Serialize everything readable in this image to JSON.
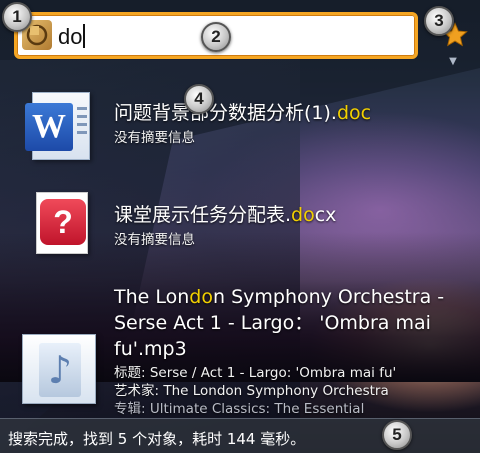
{
  "search": {
    "query": "do",
    "app_icon": "app-logo-icon",
    "favorite_icon": "star-icon",
    "dropdown_icon": "chevron-down-icon"
  },
  "results": [
    {
      "name_prefix": "问题背景部分数据分析(1).",
      "name_match": "do",
      "name_suffix": "c",
      "subtitle": "没有摘要信息",
      "icon": "word-document-icon"
    },
    {
      "name_prefix": "课堂展示任务分配表.",
      "name_match": "do",
      "name_suffix": "cx",
      "subtitle": "没有摘要信息",
      "icon": "unknown-file-icon"
    },
    {
      "line1_prefix": "The Lon",
      "line1_match": "do",
      "line1_suffix": "n Symphony Orchestra -",
      "line2": "Serse Act 1 - Largo： 'Ombra mai",
      "line3": "fu'.mp3",
      "meta_title": "标题: Serse / Act 1 - Largo: 'Ombra mai fu'",
      "meta_artist": "艺术家: The London Symphony Orchestra",
      "meta_album": "专辑: Ultimate Classics: The Essential",
      "icon": "music-file-icon"
    }
  ],
  "status": {
    "text": "搜索完成，找到 5 个对象，耗时 144 毫秒。"
  },
  "markers": [
    "1",
    "2",
    "3",
    "4",
    "5"
  ],
  "colors": {
    "search_border": "#f5a623",
    "match_highlight": "#f2d000"
  }
}
